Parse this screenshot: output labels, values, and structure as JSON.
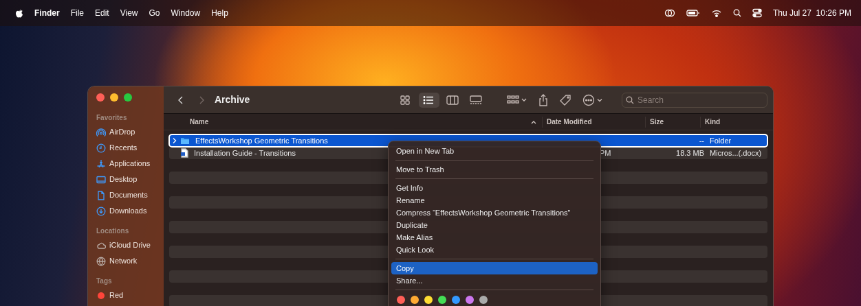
{
  "menubar": {
    "app": "Finder",
    "menus": [
      "File",
      "Edit",
      "View",
      "Go",
      "Window",
      "Help"
    ],
    "clock": "Thu Jul 27  10:26 PM"
  },
  "window": {
    "title": "Archive",
    "search": {
      "placeholder": "Search"
    },
    "view_modes": [
      {
        "kind": "icons",
        "selected": false
      },
      {
        "kind": "list",
        "selected": true
      },
      {
        "kind": "columns",
        "selected": false
      },
      {
        "kind": "gallery",
        "selected": false
      }
    ],
    "sidebar": [
      {
        "heading": "Favorites",
        "items": [
          {
            "label": "AirDrop",
            "kind": "airdrop"
          },
          {
            "label": "Recents",
            "kind": "clock"
          },
          {
            "label": "Applications",
            "kind": "apps"
          },
          {
            "label": "Desktop",
            "kind": "desktop"
          },
          {
            "label": "Documents",
            "kind": "document"
          },
          {
            "label": "Downloads",
            "kind": "download"
          }
        ]
      },
      {
        "heading": "Locations",
        "items": [
          {
            "label": "iCloud Drive",
            "kind": "cloud"
          },
          {
            "label": "Network",
            "kind": "globe"
          }
        ]
      },
      {
        "heading": "Tags",
        "items": [
          {
            "label": "Red",
            "kind": "tag",
            "color": "#ff453a"
          }
        ]
      }
    ],
    "columns": [
      "Name",
      "Date Modified",
      "Size",
      "Kind"
    ],
    "rows": [
      {
        "name": "EffectsWorkshop Geometric Transitions",
        "kind": "folder",
        "selected": true,
        "expanded": false,
        "date": "",
        "size": "--",
        "kind_label": "Folder"
      },
      {
        "name": "Installation Guide - Transitions",
        "kind": "document",
        "selected": false,
        "date": "PM",
        "size": "18.3 MB",
        "kind_label": "Micros...(.docx)"
      }
    ],
    "context_menu": {
      "groups": [
        [
          {
            "label": "Open in New Tab",
            "selected": false
          }
        ],
        [
          {
            "label": "Move to Trash",
            "selected": false
          }
        ],
        [
          {
            "label": "Get Info",
            "selected": false
          },
          {
            "label": "Rename",
            "selected": false
          },
          {
            "label": "Compress “EffectsWorkshop Geometric Transitions”",
            "selected": false
          },
          {
            "label": "Duplicate",
            "selected": false
          },
          {
            "label": "Make Alias",
            "selected": false
          },
          {
            "label": "Quick Look",
            "selected": false
          }
        ],
        [
          {
            "label": "Copy",
            "selected": true
          },
          {
            "label": "Share...",
            "selected": false
          }
        ]
      ],
      "tags": [
        {
          "color": "#ff5f57"
        },
        {
          "color": "#ffaa33"
        },
        {
          "color": "#ffdd33"
        },
        {
          "color": "#44dd55"
        },
        {
          "color": "#3399ff"
        },
        {
          "color": "#cc77ee"
        },
        {
          "color": "#aaaaaa"
        }
      ]
    }
  }
}
